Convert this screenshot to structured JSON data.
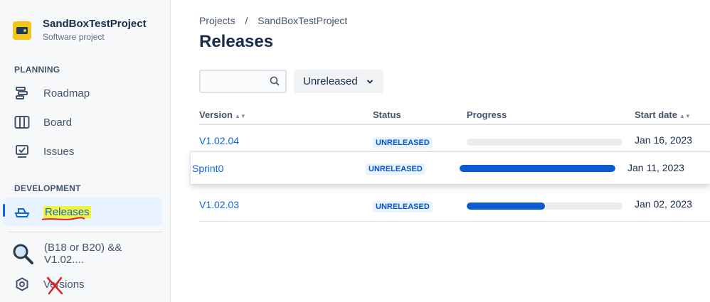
{
  "project": {
    "name": "SandBoxTestProject",
    "type": "Software project"
  },
  "sidebar": {
    "planning_title": "PLANNING",
    "planning_items": [
      {
        "label": "Roadmap",
        "icon": "roadmap-icon"
      },
      {
        "label": "Board",
        "icon": "board-icon"
      },
      {
        "label": "Issues",
        "icon": "issues-icon"
      }
    ],
    "development_title": "DEVELOPMENT",
    "development_items": [
      {
        "label": "Releases",
        "icon": "ship-icon",
        "active": true
      }
    ],
    "extra_items": [
      {
        "label": "(B18 or B20) && V1.02....",
        "icon": "magnifier-icon"
      },
      {
        "label": "Versions",
        "icon": "hexagon-icon"
      }
    ]
  },
  "breadcrumbs": [
    "Projects",
    "/",
    "SandBoxTestProject"
  ],
  "page_title": "Releases",
  "search": {
    "placeholder": "",
    "value": ""
  },
  "filter": {
    "selected": "Unreleased"
  },
  "table": {
    "headers": {
      "version": "Version",
      "status": "Status",
      "progress": "Progress",
      "start_date": "Start date"
    },
    "rows": [
      {
        "version": "V1.02.04",
        "status": "UNRELEASED",
        "progress": 0.0,
        "start_date": "Jan 16, 2023"
      },
      {
        "version": "Sprint0",
        "status": "UNRELEASED",
        "progress": 1.0,
        "start_date": "Jan 11, 2023",
        "dragging": true
      },
      {
        "version": "V1.02.03",
        "status": "UNRELEASED",
        "progress": 0.5,
        "start_date": "Jan 02, 2023"
      }
    ]
  },
  "colors": {
    "accent": "#0c66e4",
    "highlight": "#f3f33a",
    "annotation_red": "#e02020",
    "progress_fill": "#0c5ad1"
  }
}
